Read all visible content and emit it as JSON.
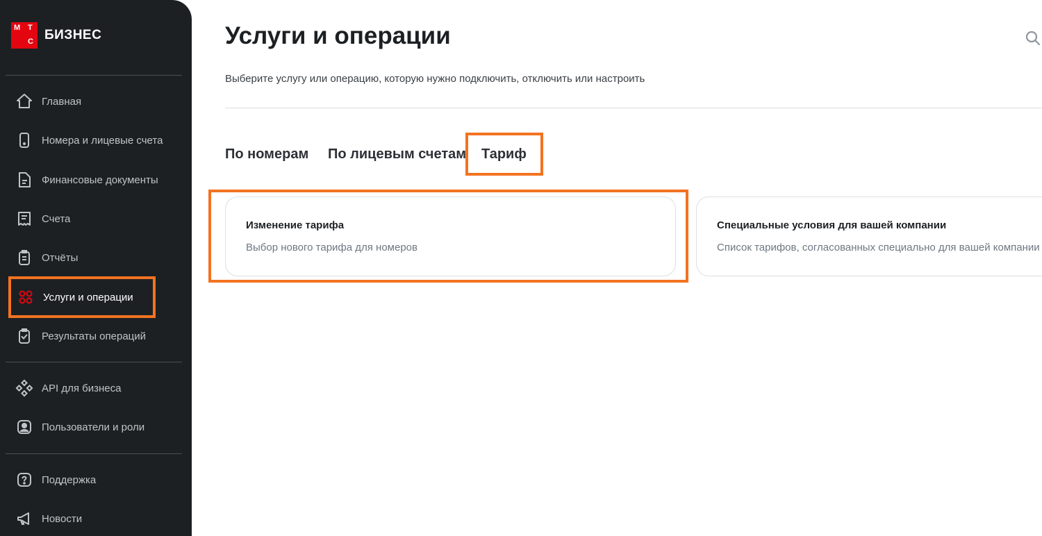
{
  "logo": {
    "letters": [
      "М",
      "Т",
      "С"
    ],
    "text": "БИЗНЕС"
  },
  "sidebar": {
    "items": [
      {
        "label": "Главная",
        "icon": "home-icon"
      },
      {
        "label": "Номера и лицевые счета",
        "icon": "phone-icon"
      },
      {
        "label": "Финансовые документы",
        "icon": "document-icon"
      },
      {
        "label": "Счета",
        "icon": "receipt-icon"
      },
      {
        "label": "Отчёты",
        "icon": "clipboard-icon"
      },
      {
        "label": "Услуги и операции",
        "icon": "services-icon",
        "active": true
      },
      {
        "label": "Результаты операций",
        "icon": "clipboard-check-icon"
      },
      {
        "label": "API для бизнеса",
        "icon": "api-icon"
      },
      {
        "label": "Пользователи и роли",
        "icon": "user-icon"
      },
      {
        "label": "Поддержка",
        "icon": "support-icon"
      },
      {
        "label": "Новости",
        "icon": "megaphone-icon"
      }
    ]
  },
  "header": {
    "title": "Услуги и операции",
    "subtitle": "Выберите услугу или операцию, которую нужно подключить, отключить или настроить"
  },
  "tabs": [
    {
      "label": "По номерам"
    },
    {
      "label": "По лицевым счетам"
    },
    {
      "label": "Тариф",
      "active": true
    }
  ],
  "cards": [
    {
      "title": "Изменение тарифа",
      "description": "Выбор нового тарифа для номеров"
    },
    {
      "title": "Специальные условия для вашей компании",
      "description": "Список тарифов, согласованных специально для вашей компании"
    }
  ],
  "colors": {
    "accent": "#e30611",
    "highlight": "#f37321",
    "sidebar_bg": "#1d2023"
  }
}
